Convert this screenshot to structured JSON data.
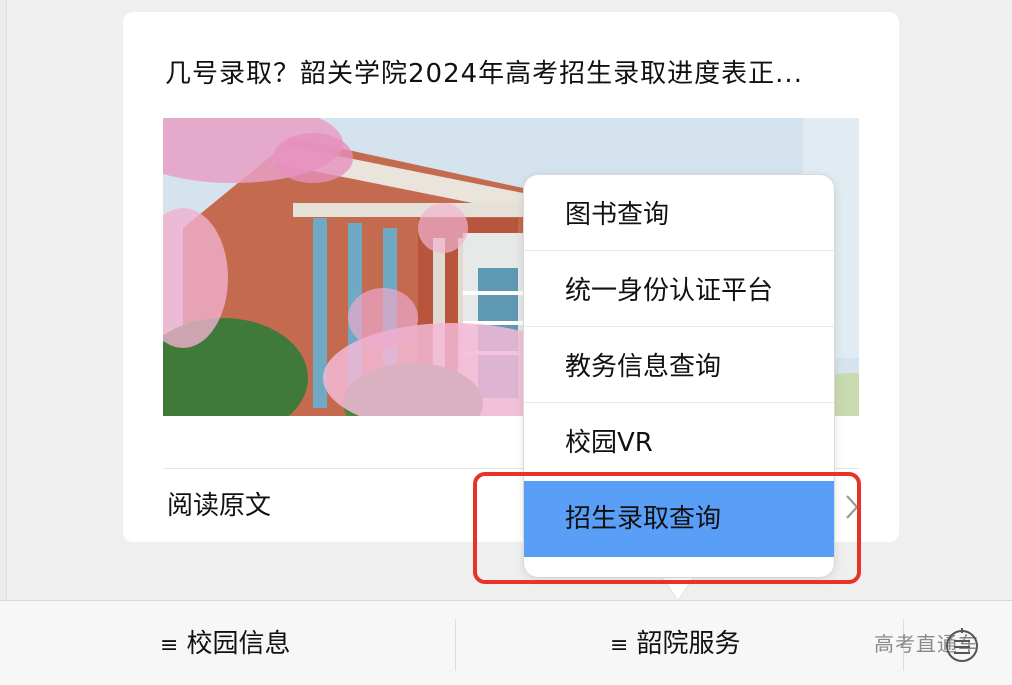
{
  "article": {
    "title": "几号录取？韶关学院2024年高考招生录取进度表正...",
    "read_original": "阅读原文"
  },
  "popup_menu": {
    "items": [
      {
        "label": "图书查询"
      },
      {
        "label": "统一身份认证平台"
      },
      {
        "label": "教务信息查询"
      },
      {
        "label": "校园VR"
      },
      {
        "label": "招生录取查询",
        "selected": true
      }
    ]
  },
  "bottom_tabs": [
    {
      "glyph": "≡",
      "label": "校园信息"
    },
    {
      "glyph": "≡",
      "label": "韶院服务"
    }
  ],
  "watermark": "高考直通车",
  "colors": {
    "selected_bg": "#5a9ff7",
    "highlight": "#e8322b",
    "page_bg": "#efefef"
  }
}
